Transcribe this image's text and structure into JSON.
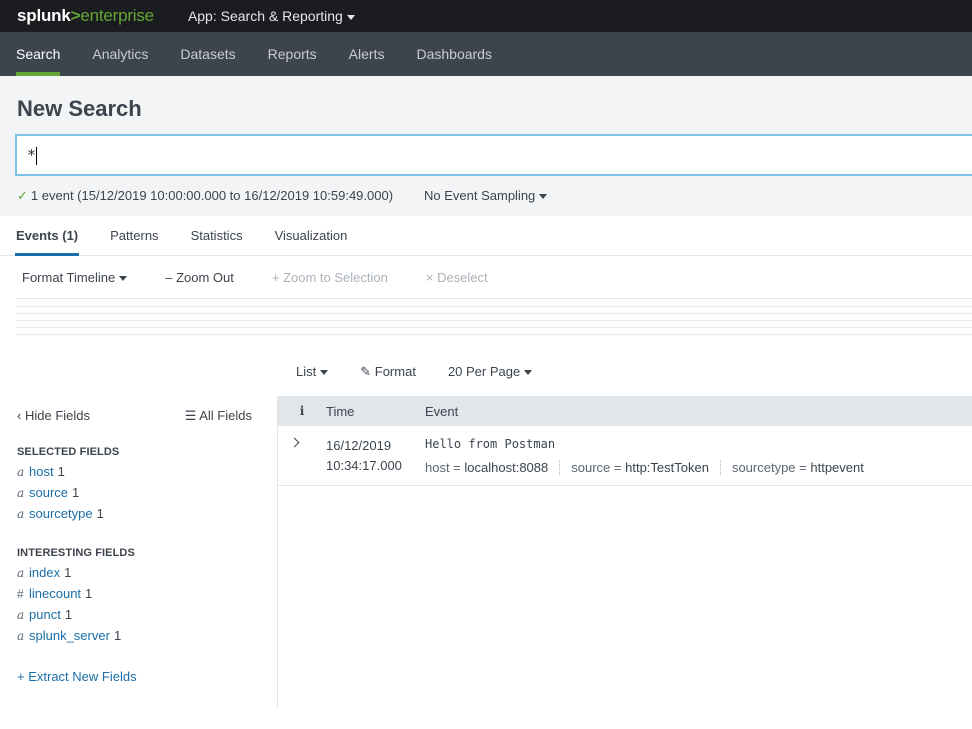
{
  "topbar": {
    "logo_splunk": "splunk",
    "logo_gt": ">",
    "logo_product": "enterprise",
    "app_menu": "App: Search & Reporting"
  },
  "nav": {
    "items": [
      "Search",
      "Analytics",
      "Datasets",
      "Reports",
      "Alerts",
      "Dashboards"
    ],
    "active": "Search"
  },
  "search": {
    "title": "New Search",
    "query": "*",
    "status": "1 event (15/12/2019 10:00:00.000 to 16/12/2019 10:59:49.000)",
    "sampling": "No Event Sampling"
  },
  "tabs": [
    "Events (1)",
    "Patterns",
    "Statistics",
    "Visualization"
  ],
  "timeline": {
    "format": "Format Timeline",
    "zoom_out": "Zoom Out",
    "zoom_selection": "Zoom to Selection",
    "deselect": "Deselect"
  },
  "results_toolbar": {
    "list": "List",
    "format": "Format",
    "per_page": "20 Per Page"
  },
  "sidebar": {
    "hide_fields": "Hide Fields",
    "all_fields": "All Fields",
    "selected_title": "SELECTED FIELDS",
    "selected": [
      {
        "type": "a",
        "name": "host",
        "count": "1"
      },
      {
        "type": "a",
        "name": "source",
        "count": "1"
      },
      {
        "type": "a",
        "name": "sourcetype",
        "count": "1"
      }
    ],
    "interesting_title": "INTERESTING FIELDS",
    "interesting": [
      {
        "type": "a",
        "name": "index",
        "count": "1"
      },
      {
        "type": "#",
        "name": "linecount",
        "count": "1"
      },
      {
        "type": "a",
        "name": "punct",
        "count": "1"
      },
      {
        "type": "a",
        "name": "splunk_server",
        "count": "1"
      }
    ],
    "extract": "+ Extract New Fields"
  },
  "events": {
    "header": {
      "info": "i",
      "time": "Time",
      "event": "Event"
    },
    "rows": [
      {
        "date": "16/12/2019",
        "time": "10:34:17.000",
        "raw": "Hello from Postman",
        "fields": [
          {
            "key": "host =",
            "value": "localhost:8088"
          },
          {
            "key": "source =",
            "value": "http:TestToken"
          },
          {
            "key": "sourcetype =",
            "value": "httpevent"
          }
        ]
      }
    ]
  },
  "colors": {
    "accent_green": "#65a637",
    "link_blue": "#1a6ea8",
    "nav_bg": "#3c444d",
    "topbar_bg": "#1a1c20"
  }
}
